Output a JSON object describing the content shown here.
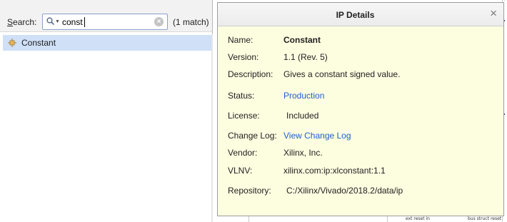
{
  "search": {
    "label": "Search:",
    "value": "const",
    "clear_icon": "×",
    "match_count": "(1 match)"
  },
  "results": [
    {
      "label": "Constant",
      "icon": "ip-core-icon"
    }
  ],
  "details": {
    "title": "IP Details",
    "close_icon": "×",
    "fields": {
      "name": {
        "label": "Name:",
        "value": "Constant"
      },
      "version": {
        "label": "Version:",
        "value": "1.1 (Rev. 5)"
      },
      "description": {
        "label": "Description:",
        "value": "Gives a constant signed value."
      },
      "status": {
        "label": "Status:",
        "value": "Production"
      },
      "license": {
        "label": "License:",
        "value": "Included"
      },
      "change_log": {
        "label": "Change Log:",
        "value": "View Change Log"
      },
      "vendor": {
        "label": "Vendor:",
        "value": "Xilinx, Inc."
      },
      "vlnv": {
        "label": "VLNV:",
        "value": "xilinx.com:ip:xlconstant:1.1"
      },
      "repository": {
        "label": "Repository:",
        "value": "C:/Xilinx/Vivado/2018.2/data/ip"
      }
    },
    "link_color": "#1b5fd6",
    "background_color": "#fdfde0"
  },
  "background_canvas": {
    "port_labels": [
      "ext reset in",
      "bus struct reset"
    ]
  },
  "colors": {
    "selection": "#cfe0f7",
    "accent": "#1b5fd6"
  }
}
